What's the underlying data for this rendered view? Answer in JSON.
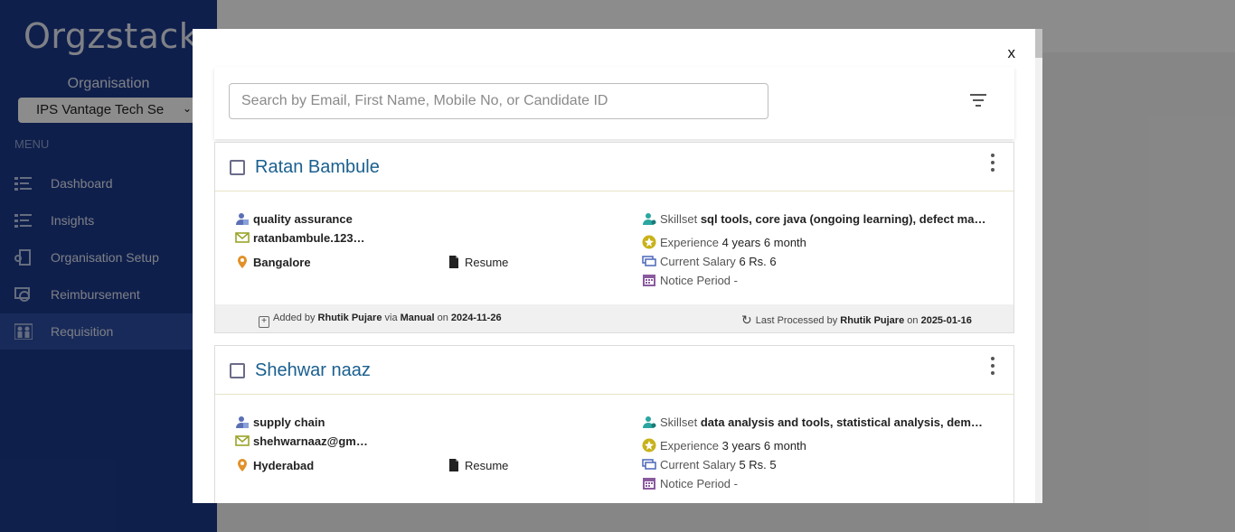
{
  "sidebar": {
    "logo": "Orgzstack",
    "org_label": "Organisation",
    "org_value": "IPS Vantage Tech Se",
    "menu_label": "MENU",
    "items": [
      {
        "label": "Dashboard",
        "icon": "list-icon"
      },
      {
        "label": "Insights",
        "icon": "list-icon"
      },
      {
        "label": "Organisation Setup",
        "icon": "building-icon"
      },
      {
        "label": "Reimbursement",
        "icon": "money-icon"
      },
      {
        "label": "Requisition",
        "icon": "people-icon",
        "active": true
      }
    ]
  },
  "modal": {
    "close_label": "x",
    "search_placeholder": "Search by Email, First Name, Mobile No, or Candidate ID",
    "candidates": [
      {
        "name": "Ratan Bambule",
        "domain": "quality assurance",
        "email": "ratanbambule.123…",
        "location": "Bangalore",
        "resume_label": "Resume",
        "skillset_label": "Skillset",
        "skillset": "sql tools, core java (ongoing learning), defect ma…",
        "experience_label": "Experience",
        "experience": "4 years 6 month",
        "salary_label": "Current Salary",
        "salary": "6 Rs. 6",
        "notice_label": "Notice Period -",
        "added_prefix": "Added by",
        "added_by": "Rhutik Pujare",
        "via_word": "via",
        "via": "Manual",
        "on_word": "on",
        "added_on": "2024-11-26",
        "processed_prefix": "Last Processed by",
        "processed_by": "Rhutik Pujare",
        "processed_on": "2025-01-16"
      },
      {
        "name": "Shehwar naaz",
        "domain": "supply chain",
        "email": "shehwarnaaz@gm…",
        "location": "Hyderabad",
        "resume_label": "Resume",
        "skillset_label": "Skillset",
        "skillset": "data analysis and tools, statistical analysis, dem…",
        "experience_label": "Experience",
        "experience": "3 years 6 month",
        "salary_label": "Current Salary",
        "salary": "5 Rs. 5",
        "notice_label": "Notice Period -"
      }
    ]
  }
}
